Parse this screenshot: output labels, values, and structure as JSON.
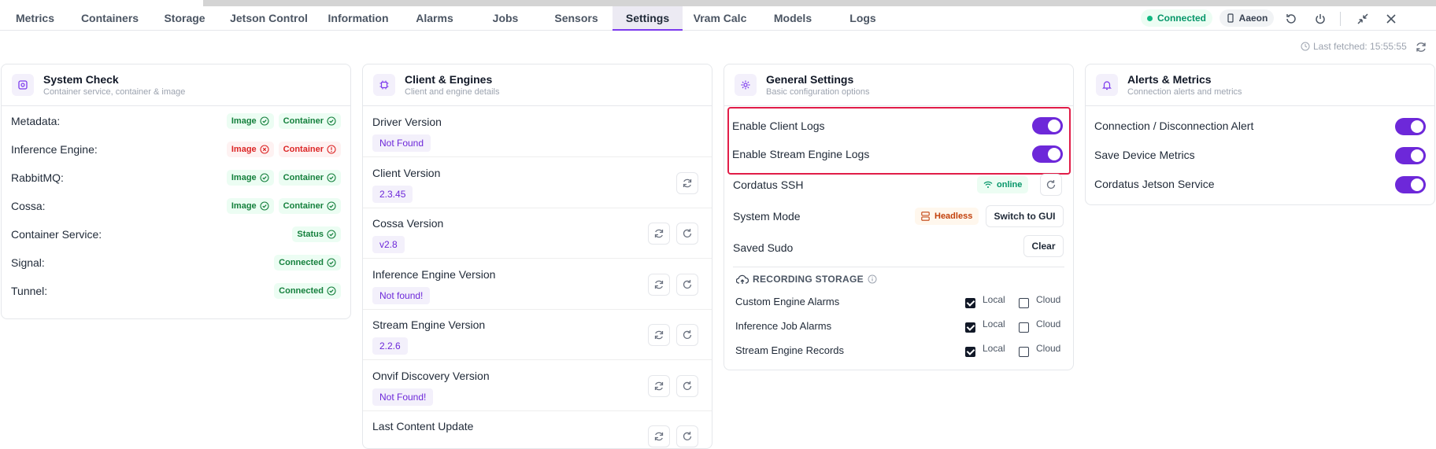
{
  "nav": {
    "tabs": [
      "Metrics",
      "Containers",
      "Storage",
      "Jetson Control",
      "Information",
      "Alarms",
      "Jobs",
      "Sensors",
      "Settings",
      "Vram Calc",
      "Models",
      "Logs"
    ],
    "active_tab": "Settings",
    "status": "Connected",
    "device": "Aaeon"
  },
  "fetched": {
    "text": "Last fetched: 15:55:55"
  },
  "system_check": {
    "title": "System Check",
    "subtitle": "Container service, container & image",
    "rows": [
      {
        "label": "Metadata:",
        "badges": [
          {
            "text": "Image",
            "state": "ok"
          },
          {
            "text": "Container",
            "state": "ok"
          }
        ]
      },
      {
        "label": "Inference Engine:",
        "badges": [
          {
            "text": "Image",
            "state": "err"
          },
          {
            "text": "Container",
            "state": "warn"
          }
        ]
      },
      {
        "label": "RabbitMQ:",
        "badges": [
          {
            "text": "Image",
            "state": "ok"
          },
          {
            "text": "Container",
            "state": "ok"
          }
        ]
      },
      {
        "label": "Cossa:",
        "badges": [
          {
            "text": "Image",
            "state": "ok"
          },
          {
            "text": "Container",
            "state": "ok"
          }
        ]
      },
      {
        "label": "Container Service:",
        "badges": [
          {
            "text": "Status",
            "state": "ok"
          }
        ]
      },
      {
        "label": "Signal:",
        "badges": [
          {
            "text": "Connected",
            "state": "ok"
          }
        ]
      },
      {
        "label": "Tunnel:",
        "badges": [
          {
            "text": "Connected",
            "state": "ok"
          }
        ]
      }
    ]
  },
  "client_engines": {
    "title": "Client & Engines",
    "subtitle": "Client and engine details",
    "versions": [
      {
        "label": "Driver Version",
        "value": "Not Found"
      },
      {
        "label": "Client Version",
        "value": "2.3.45"
      },
      {
        "label": "Cossa Version",
        "value": "v2.8"
      },
      {
        "label": "Inference Engine Version",
        "value": "Not found!"
      },
      {
        "label": "Stream Engine Version",
        "value": "2.2.6"
      },
      {
        "label": "Onvif Discovery Version",
        "value": "Not Found!"
      },
      {
        "label": "Last Content Update",
        "value": ""
      }
    ]
  },
  "general": {
    "title": "General Settings",
    "subtitle": "Basic configuration options",
    "enable_client_logs": "Enable Client Logs",
    "enable_stream_logs": "Enable Stream Engine Logs",
    "ssh_label": "Cordatus SSH",
    "ssh_status": "online",
    "mode_label": "System Mode",
    "mode_value": "Headless",
    "mode_button": "Switch to GUI",
    "sudo_label": "Saved Sudo",
    "sudo_button": "Clear",
    "storage_heading": "RECORDING STORAGE",
    "storage_rows": [
      {
        "label": "Custom Engine Alarms",
        "local": true,
        "cloud": false
      },
      {
        "label": "Inference Job Alarms",
        "local": true,
        "cloud": false
      },
      {
        "label": "Stream Engine Records",
        "local": true,
        "cloud": false
      }
    ],
    "local_label": "Local",
    "cloud_label": "Cloud"
  },
  "alerts": {
    "title": "Alerts & Metrics",
    "subtitle": "Connection alerts and metrics",
    "items": [
      "Connection / Disconnection Alert",
      "Save Device Metrics",
      "Cordatus Jetson Service"
    ]
  }
}
